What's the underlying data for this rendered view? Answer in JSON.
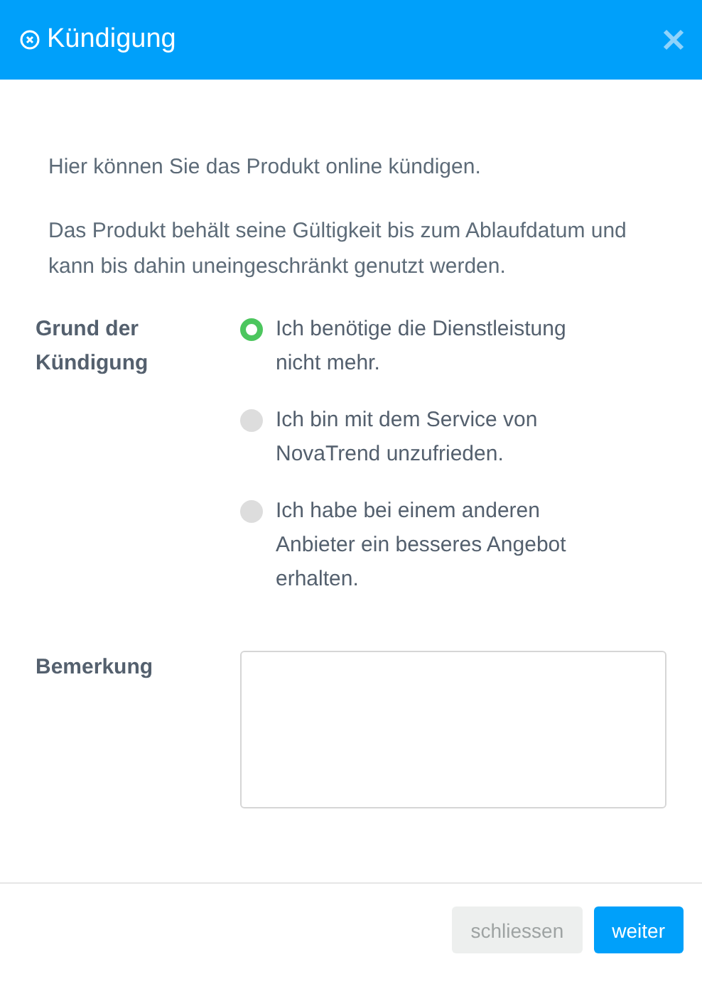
{
  "dialog": {
    "title": "Kündigung"
  },
  "intro": [
    "Hier können Sie das Produkt online kündigen.",
    "Das Produkt behält seine Gültigkeit bis zum Ablaufdatum und kann bis dahin uneingeschränkt genutzt werden."
  ],
  "reason": {
    "label": "Grund der Kündigung",
    "options": [
      {
        "label": "Ich benötige die Dienstleistung nicht mehr.",
        "selected": true
      },
      {
        "label": "Ich bin mit dem Service von NovaTrend unzufrieden.",
        "selected": false
      },
      {
        "label": "Ich habe bei einem anderen Anbieter ein besseres Angebot erhalten.",
        "selected": false
      }
    ]
  },
  "remark": {
    "label": "Bemerkung"
  },
  "buttons": [
    {
      "label": "schliessen",
      "kind": "secondary",
      "disabled": true
    },
    {
      "label": "weiter",
      "kind": "primary",
      "disabled": false
    }
  ]
}
